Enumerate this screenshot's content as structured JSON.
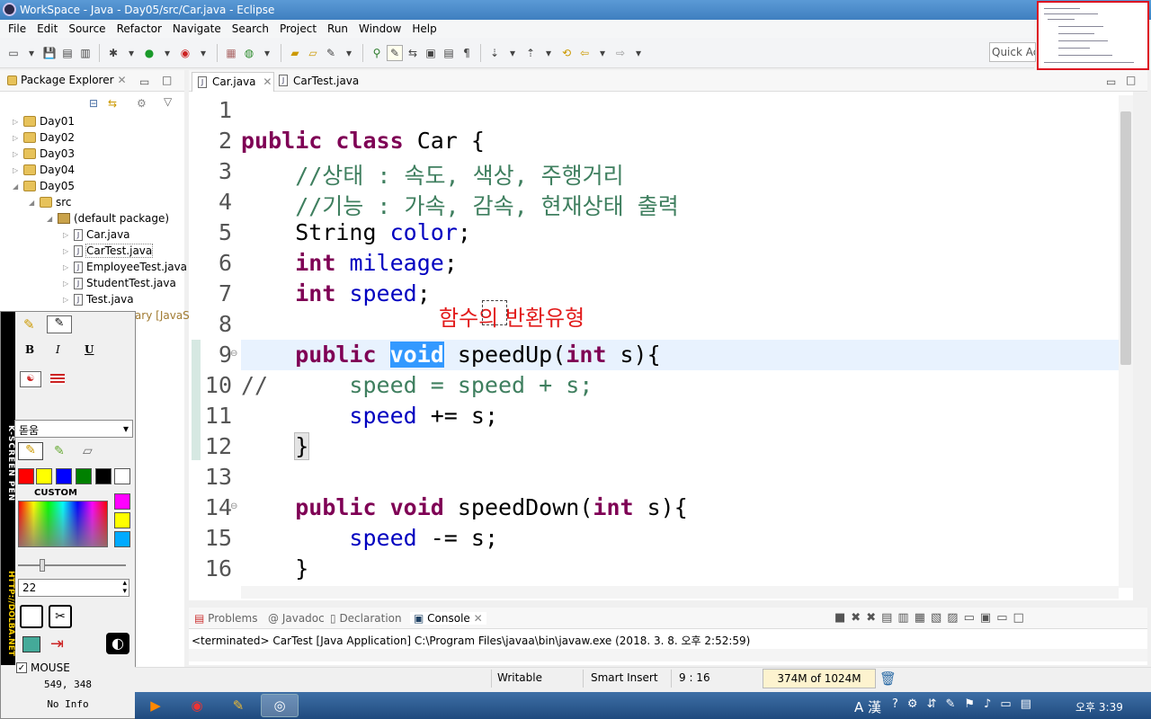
{
  "window": {
    "title": "WorkSpace - Java - Day05/src/Car.java - Eclipse"
  },
  "menu": [
    "File",
    "Edit",
    "Source",
    "Refactor",
    "Navigate",
    "Search",
    "Project",
    "Run",
    "Window",
    "Help"
  ],
  "toolbar": {
    "quick_access": "Quick Ac"
  },
  "explorer": {
    "tab_label": "Package Explorer",
    "items": [
      {
        "label": "Day01",
        "level": 0,
        "kind": "project"
      },
      {
        "label": "Day02",
        "level": 0,
        "kind": "project"
      },
      {
        "label": "Day03",
        "level": 0,
        "kind": "project"
      },
      {
        "label": "Day04",
        "level": 0,
        "kind": "project"
      },
      {
        "label": "Day05",
        "level": 0,
        "kind": "project"
      },
      {
        "label": "src",
        "level": 1,
        "kind": "folder"
      },
      {
        "label": "(default package)",
        "level": 2,
        "kind": "package"
      },
      {
        "label": "Car.java",
        "level": 3,
        "kind": "file"
      },
      {
        "label": "CarTest.java",
        "level": 3,
        "kind": "file"
      },
      {
        "label": "EmployeeTest.java",
        "level": 3,
        "kind": "file"
      },
      {
        "label": "StudentTest.java",
        "level": 3,
        "kind": "file"
      },
      {
        "label": "Test.java",
        "level": 3,
        "kind": "file"
      }
    ],
    "partial_text": "rary [JavaS"
  },
  "kscreen": {
    "title": "K-SCREEN PEN",
    "url": "HTTP://DOLBA.NET",
    "font": "돋움",
    "custom_label": "CUSTOM",
    "size": "22",
    "mouse_label": "MOUSE",
    "coords": "549, 348",
    "info": "No Info",
    "colors": [
      "#ff0000",
      "#ffff00",
      "#0000ff",
      "#008000",
      "#000000",
      "#ffffff"
    ],
    "custom_colors": [
      "#ff00ff",
      "#ffff00",
      "#00aaff"
    ]
  },
  "editor": {
    "tabs": [
      "Car.java",
      "CarTest.java"
    ],
    "line_numbers": [
      "1",
      "2",
      "3",
      "4",
      "5",
      "6",
      "7",
      "8",
      "9",
      "10",
      "11",
      "12",
      "13",
      "14",
      "15",
      "16"
    ],
    "annotation": "함수의 반환유형",
    "code": {
      "l2": {
        "kw1": "public",
        "kw2": "class",
        "name": " Car {"
      },
      "l3": "    //상태 : 속도, 색상, 주행거리",
      "l4": "    //기능 : 가속, 감속, 현재상태 출력",
      "l5": {
        "type": "String",
        "field": "color",
        "end": ";"
      },
      "l6": {
        "type": "int",
        "field": "mileage",
        "end": ";"
      },
      "l7": {
        "type": "int",
        "field": "speed",
        "end": ";"
      },
      "l9": {
        "kw1": "public",
        "sel": "void",
        "rest": " speedUp(",
        "kw2": "int",
        "arg": " s){"
      },
      "l10": {
        "prefix": "//",
        "body": "      speed = speed + s;"
      },
      "l11": {
        "field": "speed",
        "rest": " += s;"
      },
      "l12": "}",
      "l14": {
        "kw1": "public",
        "kw2": "void",
        "rest": " speedDown(",
        "kw3": "int",
        "arg": " s){"
      },
      "l15": {
        "field": "speed",
        "rest": " -= s;"
      },
      "l16": "}"
    }
  },
  "console": {
    "tabs": [
      "Problems",
      "Javadoc",
      "Declaration",
      "Console"
    ],
    "text": "<terminated> CarTest [Java Application] C:\\Program Files\\javaa\\bin\\javaw.exe (2018. 3. 8. 오후 2:52:59)"
  },
  "status": {
    "writable": "Writable",
    "insert": "Smart Insert",
    "position": "9 : 16",
    "heap": "374M of 1024M"
  },
  "taskbar": {
    "clock": "오후 3:39",
    "ime": "A 漢"
  }
}
